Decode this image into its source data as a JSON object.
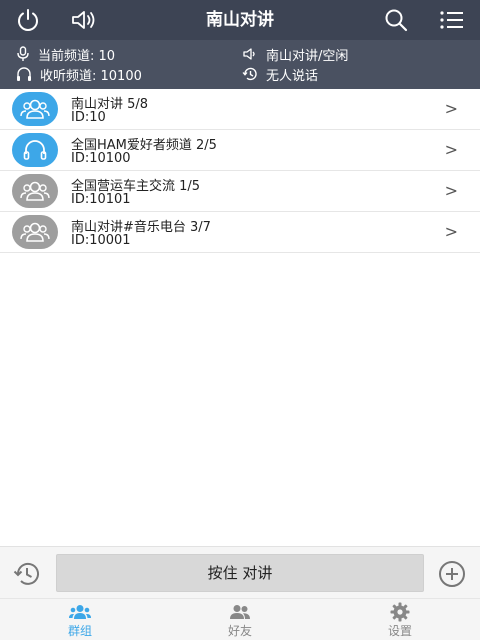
{
  "header": {
    "title": "南山对讲"
  },
  "status": {
    "current_channel": "当前频道: 10",
    "listen_channel": "收听频道: 10100",
    "channel_state": "南山对讲/空闲",
    "speaker_state": "无人说话"
  },
  "groups": [
    {
      "name": "南山对讲 5/8",
      "id": "ID:10",
      "avatar_color": "#3da7e8",
      "icon": "group-icon"
    },
    {
      "name": "全国HAM爱好者频道 2/5",
      "id": "ID:10100",
      "avatar_color": "#3da7e8",
      "icon": "headphones-icon"
    },
    {
      "name": "全国营运车主交流 1/5",
      "id": "ID:10101",
      "avatar_color": "#9e9e9e",
      "icon": "group-icon"
    },
    {
      "name": "南山对讲#音乐电台 3/7",
      "id": "ID:10001",
      "avatar_color": "#9e9e9e",
      "icon": "group-icon"
    }
  ],
  "ptt": {
    "label": "按住 对讲"
  },
  "nav": {
    "groups": "群组",
    "friends": "好友",
    "settings": "设置",
    "active": "groups"
  },
  "colors": {
    "topbar": "#3d4454",
    "status_panel": "#4a5161",
    "accent": "#3da7e8",
    "inactive_avatar": "#9e9e9e"
  }
}
